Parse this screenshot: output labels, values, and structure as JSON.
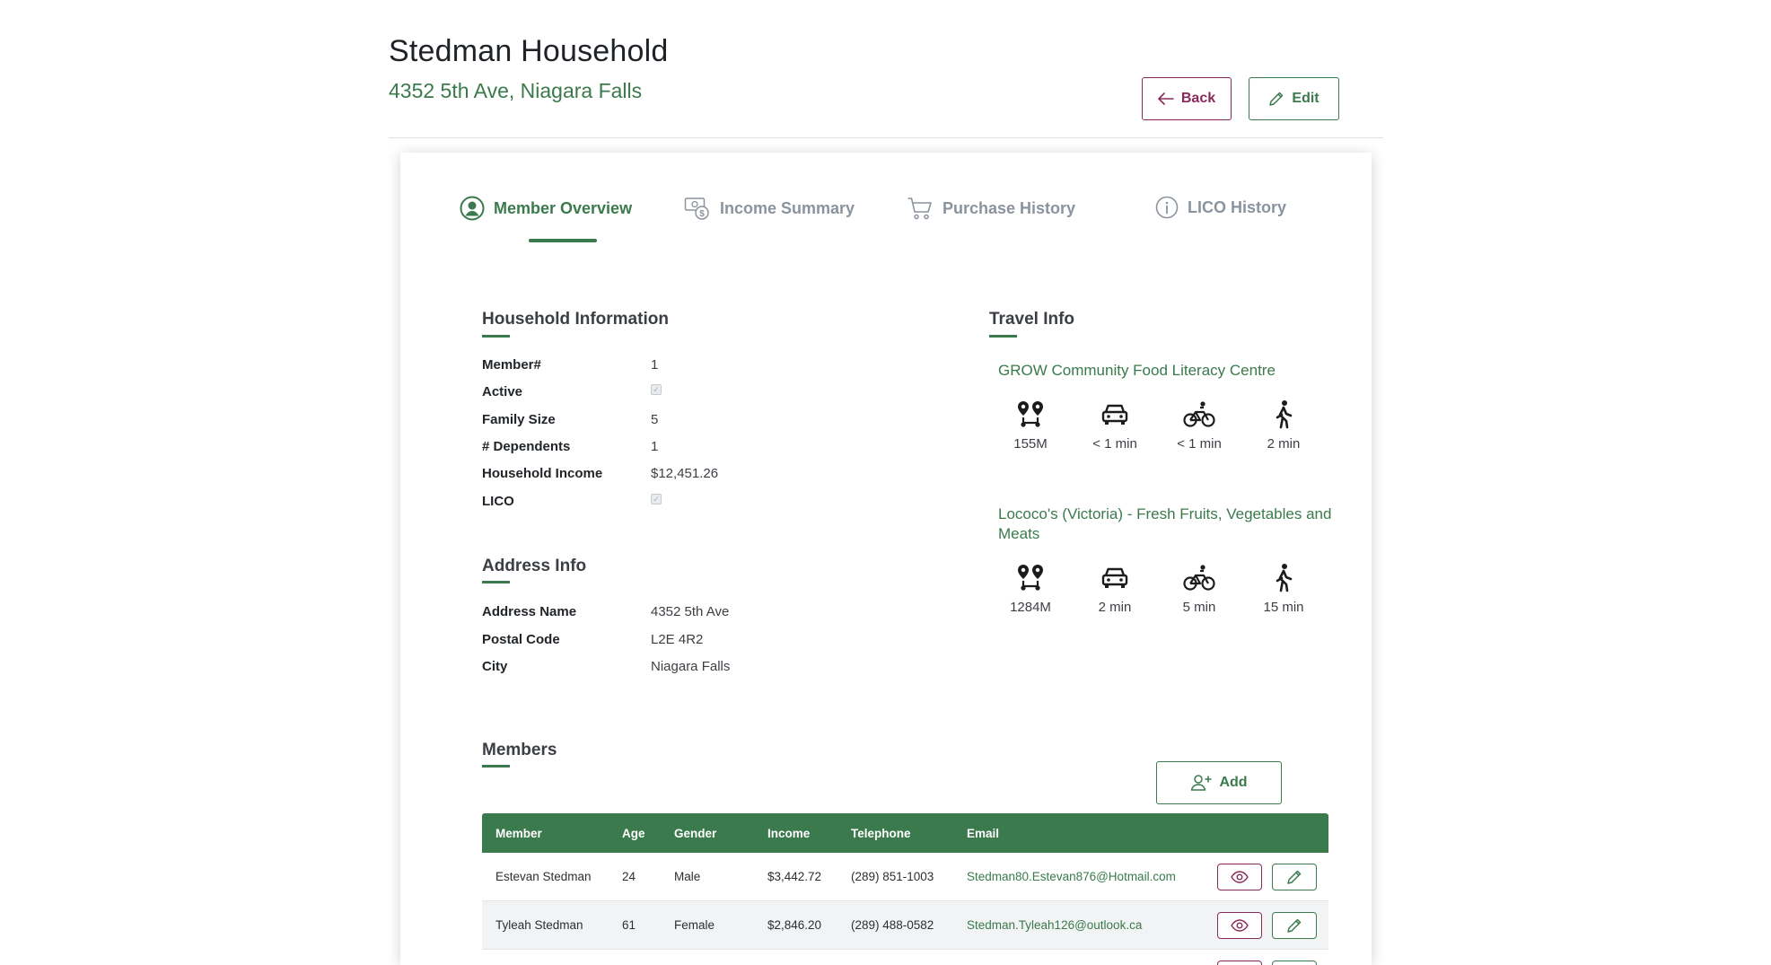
{
  "header": {
    "title": "Stedman Household",
    "address": "4352 5th Ave, Niagara Falls",
    "back_label": "Back",
    "edit_label": "Edit"
  },
  "tabs": [
    {
      "label": "Member Overview",
      "icon": "user-circle-icon",
      "active": true
    },
    {
      "label": "Income Summary",
      "icon": "money-icon",
      "active": false
    },
    {
      "label": "Purchase History",
      "icon": "cart-icon",
      "active": false
    },
    {
      "label": "LICO History",
      "icon": "info-icon",
      "active": false
    }
  ],
  "household_info": {
    "title": "Household Information",
    "rows": [
      {
        "label": "Member#",
        "value": "1"
      },
      {
        "label": "Active",
        "checked": true
      },
      {
        "label": "Family Size",
        "value": "5"
      },
      {
        "label": "# Dependents",
        "value": "1"
      },
      {
        "label": "Household Income",
        "value": "$12,451.26"
      },
      {
        "label": "LICO",
        "checked": true
      }
    ]
  },
  "address_info": {
    "title": "Address Info",
    "rows": [
      {
        "label": "Address Name",
        "value": "4352 5th Ave"
      },
      {
        "label": "Postal Code",
        "value": "L2E 4R2"
      },
      {
        "label": "City",
        "value": "Niagara Falls"
      }
    ]
  },
  "travel_info": {
    "title": "Travel Info",
    "destinations": [
      {
        "name": "GROW Community Food Literacy Centre",
        "distance": "155M",
        "drive": "< 1 min",
        "bike": "< 1 min",
        "walk": "2 min"
      },
      {
        "name": "Lococo's (Victoria) - Fresh Fruits, Vegetables and Meats",
        "distance": "1284M",
        "drive": "2 min",
        "bike": "5 min",
        "walk": "15 min"
      }
    ]
  },
  "members": {
    "title": "Members",
    "add_label": "Add",
    "columns": [
      "Member",
      "Age",
      "Gender",
      "Income",
      "Telephone",
      "Email"
    ],
    "rows": [
      {
        "member": "Estevan Stedman",
        "age": "24",
        "gender": "Male",
        "income": "$3,442.72",
        "telephone": "(289) 851-1003",
        "email": "Stedman80.Estevan876@Hotmail.com"
      },
      {
        "member": "Tyleah Stedman",
        "age": "61",
        "gender": "Female",
        "income": "$2,846.20",
        "telephone": "(289) 488-0582",
        "email": "Stedman.Tyleah126@outlook.ca"
      }
    ]
  },
  "colors": {
    "brand_green": "#3a7a4c",
    "accent_maroon": "#8a2a5c",
    "table_header": "#3b7a4c"
  }
}
